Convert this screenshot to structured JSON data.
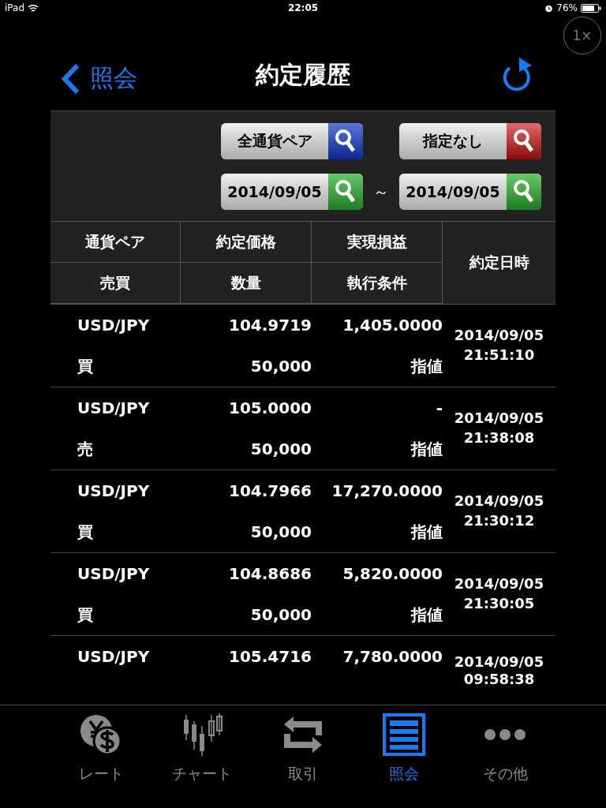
{
  "status_bar": {
    "device": "iPad",
    "time": "22:05",
    "battery": "76%"
  },
  "zoom_button": {
    "label": "1×"
  },
  "nav": {
    "back": "照会",
    "title": "約定履歴"
  },
  "filters": {
    "pair": "全通貨ペア",
    "condition": "指定なし",
    "date_from": "2014/09/05",
    "separator": "～",
    "date_to": "2014/09/05"
  },
  "table": {
    "headers": [
      [
        "通貨ペア",
        "約定価格",
        "実現損益"
      ],
      [
        "売買",
        "数量",
        "執行条件"
      ]
    ],
    "datetime_header": "約定日時",
    "rows": [
      {
        "pair": "USD/JPY",
        "price": "104.9719",
        "pnl": "1,405.0000",
        "side": "買",
        "quantity": "50,000",
        "condition": "指値",
        "date": "2014/09/05",
        "time": "21:51:10"
      },
      {
        "pair": "USD/JPY",
        "price": "105.0000",
        "pnl": "-",
        "side": "売",
        "quantity": "50,000",
        "condition": "指値",
        "date": "2014/09/05",
        "time": "21:38:08"
      },
      {
        "pair": "USD/JPY",
        "price": "104.7966",
        "pnl": "17,270.0000",
        "side": "買",
        "quantity": "50,000",
        "condition": "指値",
        "date": "2014/09/05",
        "time": "21:30:12"
      },
      {
        "pair": "USD/JPY",
        "price": "104.8686",
        "pnl": "5,820.0000",
        "side": "買",
        "quantity": "50,000",
        "condition": "指値",
        "date": "2014/09/05",
        "time": "21:30:05"
      },
      {
        "pair": "USD/JPY",
        "price": "105.4716",
        "pnl": "7,780.0000",
        "date": "2014/09/05",
        "time": "09:58:38"
      }
    ]
  },
  "tab_bar": [
    {
      "kind": "rate",
      "label": "レート",
      "selected": false
    },
    {
      "kind": "chart",
      "label": "チャート",
      "selected": false
    },
    {
      "kind": "trade",
      "label": "取引",
      "selected": false
    },
    {
      "kind": "inquiry",
      "label": "照会",
      "selected": true
    },
    {
      "kind": "more",
      "label": "その他",
      "selected": false
    }
  ]
}
